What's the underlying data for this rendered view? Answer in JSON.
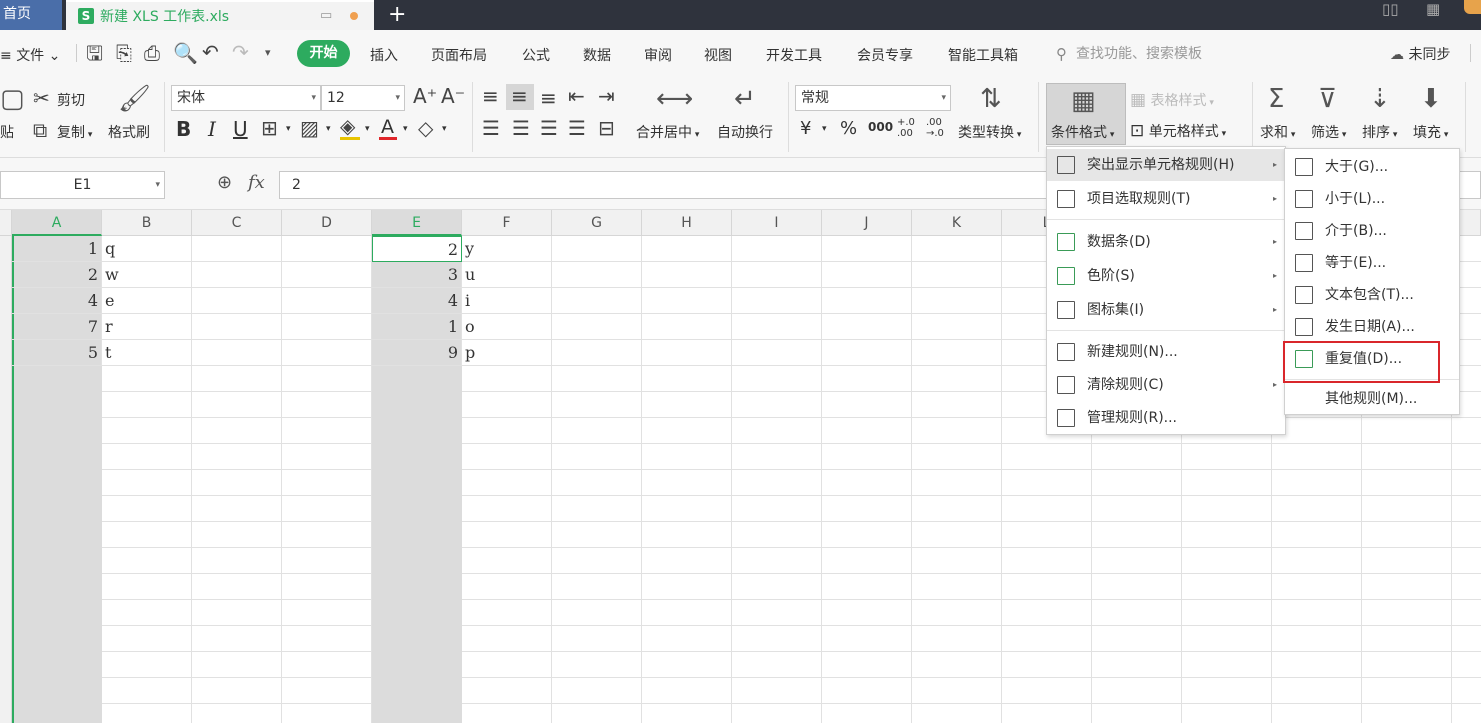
{
  "tabs": {
    "home": "首页",
    "doc_title": "新建 XLS 工作表.xls",
    "doc_logo": "S",
    "plus": "+"
  },
  "menubar": {
    "file": "文件",
    "items": [
      "开始",
      "插入",
      "页面布局",
      "公式",
      "数据",
      "审阅",
      "视图",
      "开发工具",
      "会员专享",
      "智能工具箱"
    ],
    "search_placeholder": "查找功能、搜索模板",
    "sync": "未同步"
  },
  "ribbon": {
    "paste": "贴",
    "cut": "剪切",
    "copy": "复制",
    "format_painter": "格式刷",
    "font_name": "宋体",
    "font_size": "12",
    "merge_center": "合并居中",
    "wrap_text": "自动换行",
    "number_format": "常规",
    "type_convert": "类型转换",
    "table_style": "表格样式",
    "conditional_format": "条件格式",
    "cell_style": "单元格样式",
    "sum": "求和",
    "filter": "筛选",
    "sort": "排序",
    "fill": "填充",
    "currency_symbol": "¥",
    "percent_symbol": "%",
    "thousands": "000",
    "inc_decimal": "+.0 .00",
    "dec_decimal": ".00 →.0",
    "bold": "B",
    "italic": "I",
    "underline": "U",
    "font_color_letter": "A",
    "grow_font": "A⁺",
    "shrink_font": "A⁻"
  },
  "formula": {
    "name_box": "E1",
    "fx": "fx",
    "value": "2"
  },
  "grid": {
    "columns": [
      "A",
      "B",
      "C",
      "D",
      "E",
      "F",
      "G",
      "H",
      "I",
      "J",
      "K",
      "L"
    ],
    "col_a": [
      "1",
      "2",
      "4",
      "7",
      "5"
    ],
    "col_b": [
      "q",
      "w",
      "e",
      "r",
      "t"
    ],
    "col_e": [
      "2",
      "3",
      "4",
      "1",
      "9"
    ],
    "col_f": [
      "y",
      "u",
      "i",
      "o",
      "p"
    ]
  },
  "menu_main": [
    "突出显示单元格规则(H)",
    "项目选取规则(T)",
    "数据条(D)",
    "色阶(S)",
    "图标集(I)",
    "新建规则(N)...",
    "清除规则(C)",
    "管理规则(R)..."
  ],
  "menu_sub": [
    "大于(G)...",
    "小于(L)...",
    "介于(B)...",
    "等于(E)...",
    "文本包含(T)...",
    "发生日期(A)...",
    "重复值(D)...",
    "其他规则(M)..."
  ],
  "colors": {
    "accent": "#2dab5f",
    "highlight_box": "#d9262b"
  }
}
